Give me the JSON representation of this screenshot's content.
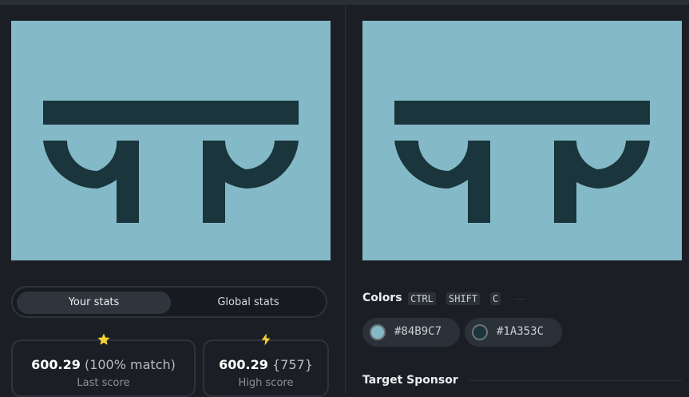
{
  "colors": {
    "background": "#84B9C7",
    "foreground": "#1A353C"
  },
  "stats": {
    "tabs": {
      "your": "Your stats",
      "global": "Global stats"
    },
    "last": {
      "score": "600.29",
      "match": "(100% match)",
      "label": "Last score"
    },
    "high": {
      "score": "600.29",
      "count": "{757}",
      "label": "High score"
    }
  },
  "colors_section": {
    "title": "Colors",
    "shortcut": [
      "CTRL",
      "SHIFT",
      "C"
    ],
    "swatches": [
      "#84B9C7",
      "#1A353C"
    ]
  },
  "sponsor": {
    "title": "Target Sponsor"
  },
  "icons": {
    "last": "star-icon",
    "high": "lightning-icon"
  }
}
